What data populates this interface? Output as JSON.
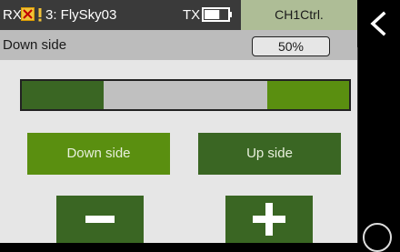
{
  "status_bar": {
    "rx_label": "RX",
    "model_name": "3: FlySky03",
    "tx_label": "TX",
    "channel_tab": "CH1Ctrl.",
    "rx_signal_icon": "x-box-icon",
    "warning_icon": "exclamation-icon",
    "battery_icon": "battery-icon",
    "battery_level": 0.65
  },
  "setting": {
    "label": "Down side",
    "value": "50%"
  },
  "range_bar": {
    "left_fraction": 0.25,
    "right_fraction": 0.25,
    "colors": {
      "left": "#3a6623",
      "middle": "#c0c0c0",
      "right": "#5a8f10"
    }
  },
  "buttons": {
    "down_side": "Down side",
    "up_side": "Up side",
    "minus_icon": "minus-icon",
    "plus_icon": "plus-icon"
  },
  "navigation": {
    "back_icon": "chevron-left-icon",
    "home_icon": "circle-icon"
  },
  "colors": {
    "active_green": "#5a8f10",
    "dark_green": "#3a6623",
    "tab_green": "#aebd96",
    "status_bg": "#3a3a3a"
  }
}
